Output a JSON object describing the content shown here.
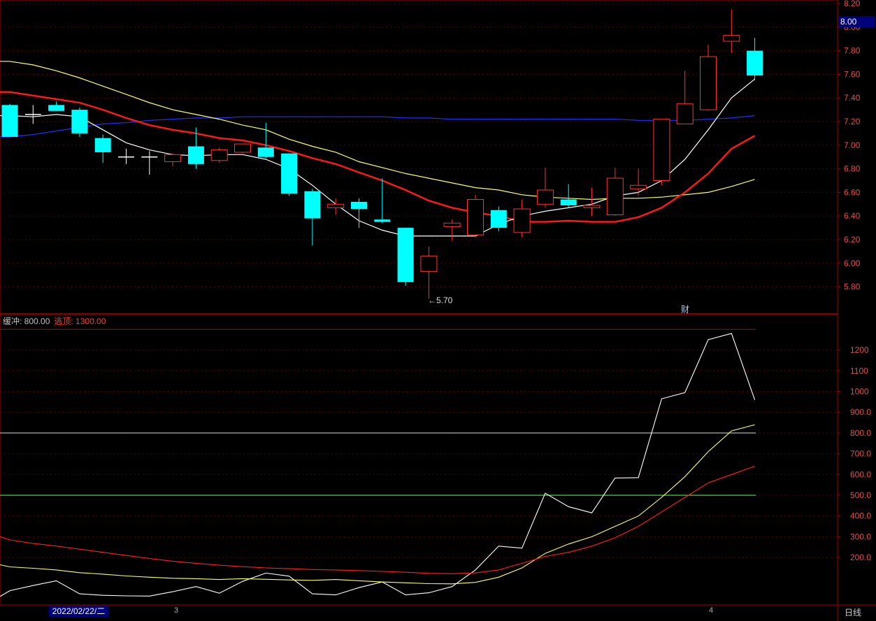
{
  "header": {
    "current_price_badge": "8.00"
  },
  "footer": {
    "date": "2022/02/22/二",
    "period": "日线",
    "month_tick_1": "3",
    "month_tick_2": "4"
  },
  "annotations": {
    "low_label": "←5.70",
    "finance_mark": "财"
  },
  "indicator_legend": {
    "buffer": "缓冲: 800.00",
    "escape": "逃顶: 1300.00"
  },
  "colors": {
    "up": "#ff3030",
    "down": "#00ffff",
    "ma5": "#ffffff",
    "ma10": "#ff1a1a",
    "ma20": "#ffff66",
    "ma60": "#2030ff",
    "grid": "#5a0000",
    "axis": "#a00000"
  },
  "chart_data": [
    {
      "type": "candlestick",
      "ylim": [
        5.65,
        8.2
      ],
      "y_ticks": [
        "8.20",
        "8.00",
        "7.80",
        "7.60",
        "7.40",
        "7.20",
        "7.00",
        "6.80",
        "6.60",
        "6.40",
        "6.20",
        "6.00",
        "5.80"
      ],
      "ohlc": [
        [
          7.34,
          7.35,
          7.07,
          7.07
        ],
        [
          7.25,
          7.34,
          7.18,
          7.26
        ],
        [
          7.34,
          7.37,
          7.29,
          7.29
        ],
        [
          7.3,
          7.32,
          7.07,
          7.1
        ],
        [
          7.06,
          7.09,
          6.85,
          6.94
        ],
        [
          6.9,
          6.97,
          6.84,
          6.9
        ],
        [
          6.9,
          6.95,
          6.75,
          6.9
        ],
        [
          6.86,
          6.93,
          6.82,
          6.92
        ],
        [
          6.99,
          7.15,
          6.8,
          6.84
        ],
        [
          6.87,
          6.98,
          6.85,
          6.96
        ],
        [
          6.94,
          7.01,
          6.93,
          7.01
        ],
        [
          6.98,
          7.19,
          6.89,
          6.9
        ],
        [
          6.93,
          6.93,
          6.57,
          6.59
        ],
        [
          6.61,
          6.63,
          6.15,
          6.38
        ],
        [
          6.47,
          6.55,
          6.41,
          6.5
        ],
        [
          6.52,
          6.55,
          6.3,
          6.46
        ],
        [
          6.37,
          6.72,
          6.34,
          6.35
        ],
        [
          6.3,
          6.3,
          5.81,
          5.84
        ],
        [
          5.93,
          6.14,
          5.7,
          6.06
        ],
        [
          6.31,
          6.37,
          6.19,
          6.34
        ],
        [
          6.24,
          6.58,
          6.22,
          6.54
        ],
        [
          6.45,
          6.48,
          6.27,
          6.3
        ],
        [
          6.26,
          6.54,
          6.22,
          6.46
        ],
        [
          6.5,
          6.81,
          6.47,
          6.62
        ],
        [
          6.54,
          6.67,
          6.47,
          6.49
        ],
        [
          6.47,
          6.64,
          6.4,
          6.49
        ],
        [
          6.41,
          6.81,
          6.4,
          6.72
        ],
        [
          6.63,
          6.8,
          6.57,
          6.66
        ],
        [
          6.7,
          7.22,
          6.66,
          7.22
        ],
        [
          7.18,
          7.63,
          7.18,
          7.35
        ],
        [
          7.3,
          7.85,
          7.29,
          7.75
        ],
        [
          7.88,
          8.15,
          7.78,
          7.93
        ],
        [
          7.8,
          7.91,
          7.55,
          7.59
        ]
      ],
      "ma5": [
        7.25,
        7.24,
        7.26,
        7.24,
        7.13,
        7.02,
        6.96,
        6.92,
        6.91,
        6.92,
        6.92,
        6.88,
        6.8,
        6.66,
        6.5,
        6.36,
        6.28,
        6.23,
        6.23,
        6.23,
        6.23,
        6.33,
        6.4,
        6.44,
        6.47,
        6.5,
        6.57,
        6.6,
        6.7,
        6.88,
        7.13,
        7.4,
        7.56
      ],
      "ma10": [
        7.45,
        7.42,
        7.39,
        7.36,
        7.3,
        7.23,
        7.17,
        7.13,
        7.1,
        7.06,
        7.04,
        7.0,
        6.95,
        6.89,
        6.84,
        6.77,
        6.7,
        6.62,
        6.53,
        6.47,
        6.43,
        6.4,
        6.35,
        6.35,
        6.36,
        6.35,
        6.35,
        6.39,
        6.47,
        6.6,
        6.76,
        6.97,
        7.08
      ],
      "ma20": [
        7.71,
        7.68,
        7.63,
        7.57,
        7.5,
        7.43,
        7.36,
        7.3,
        7.26,
        7.22,
        7.17,
        7.13,
        7.05,
        6.99,
        6.94,
        6.86,
        6.81,
        6.76,
        6.72,
        6.68,
        6.64,
        6.62,
        6.58,
        6.56,
        6.55,
        6.54,
        6.55,
        6.55,
        6.56,
        6.58,
        6.6,
        6.65,
        6.71
      ],
      "ma60": [
        7.07,
        7.09,
        7.12,
        7.15,
        7.18,
        7.19,
        7.21,
        7.22,
        7.23,
        7.23,
        7.24,
        7.24,
        7.24,
        7.24,
        7.24,
        7.24,
        7.24,
        7.23,
        7.23,
        7.22,
        7.22,
        7.22,
        7.22,
        7.22,
        7.22,
        7.22,
        7.22,
        7.21,
        7.21,
        7.21,
        7.22,
        7.23,
        7.25
      ]
    },
    {
      "type": "line",
      "ylim": [
        0,
        1300
      ],
      "y_ticks": [
        "1200",
        "1100",
        "1000",
        "900.0",
        "800.0",
        "700.0",
        "600.0",
        "500.0",
        "400.0",
        "300.0",
        "200.0"
      ],
      "levels": [
        {
          "value": 1300,
          "color": "#c00000"
        },
        {
          "value": 800,
          "color": "#d8d8d8"
        },
        {
          "value": 500,
          "color": "#66ff66"
        }
      ],
      "series": [
        {
          "color": "#ffffff",
          "values": [
            12,
            40,
            65,
            88,
            25,
            18,
            15,
            14,
            35,
            60,
            28,
            85,
            125,
            110,
            25,
            20,
            55,
            82,
            20,
            30,
            60,
            140,
            255,
            245,
            510,
            445,
            415,
            583,
            585,
            965,
            995,
            1250,
            1280,
            960
          ]
        },
        {
          "color": "#ffff66",
          "values": [
            165,
            155,
            148,
            140,
            127,
            120,
            111,
            105,
            100,
            98,
            94,
            98,
            95,
            92,
            90,
            94,
            88,
            82,
            78,
            74,
            73,
            80,
            105,
            150,
            220,
            265,
            300,
            350,
            400,
            490,
            590,
            710,
            810,
            840
          ]
        },
        {
          "color": "#ff2020",
          "values": [
            300,
            285,
            268,
            255,
            240,
            225,
            210,
            195,
            182,
            172,
            163,
            156,
            150,
            146,
            142,
            140,
            137,
            133,
            129,
            124,
            122,
            126,
            140,
            172,
            205,
            225,
            255,
            295,
            350,
            420,
            490,
            560,
            600,
            640
          ]
        }
      ]
    }
  ]
}
